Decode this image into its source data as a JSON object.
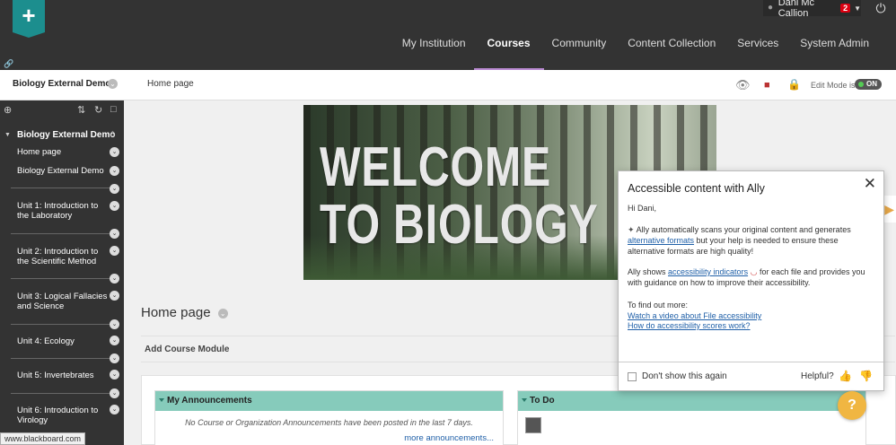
{
  "header": {
    "logo_glyph": "+",
    "user_name": "Dani Mc Callion",
    "notification_count": "2",
    "nav": [
      {
        "label": "My Institution"
      },
      {
        "label": "Courses"
      },
      {
        "label": "Community"
      },
      {
        "label": "Content Collection"
      },
      {
        "label": "Services"
      },
      {
        "label": "System Admin"
      }
    ],
    "active_nav": "Courses"
  },
  "breadcrumb": {
    "course": "Biology External Demo",
    "page": "Home page",
    "edit_mode_label": "Edit Mode is:",
    "edit_mode_value": "ON"
  },
  "sidebar": {
    "course_title": "Biology External Demo",
    "items": [
      {
        "label": "Home page"
      },
      {
        "label": "Biology External Demo"
      },
      {
        "label": "Unit 1: Introduction to the Laboratory"
      },
      {
        "label": "Unit 2: Introduction to the Scientific Method"
      },
      {
        "label": "Unit 3: Logical Fallacies and Science"
      },
      {
        "label": "Unit 4: Ecology"
      },
      {
        "label": "Unit 5: Invertebrates"
      },
      {
        "label": "Unit 6: Introduction to Virology"
      }
    ],
    "status_url": "www.blackboard.com"
  },
  "main": {
    "banner_line1": "WELCOME",
    "banner_line2": "TO BIOLOGY",
    "page_title": "Home page",
    "add_module_label": "Add Course Module",
    "announcements": {
      "title": "My Announcements",
      "empty_text": "No Course or Organization Announcements have been posted in the last 7 days.",
      "more_link": "more announcements..."
    },
    "todo": {
      "title": "To Do"
    }
  },
  "ally": {
    "title": "Accessible content with Ally",
    "greeting": "Hi Dani,",
    "p1_a": "Ally automatically scans your original content and generates",
    "p1_link": "alternative formats",
    "p1_b": "but your help is needed to ensure these alternative formats are high quality!",
    "p2_a": "Ally shows",
    "p2_link": "accessibility indicators",
    "p2_b": "for each file and provides you with guidance on how to improve their accessibility.",
    "find_out": "To find out more:",
    "link_video": "Watch a video about File accessibility",
    "link_scores": "How do accessibility scores work?",
    "dont_show": "Don't show this again",
    "helpful": "Helpful?"
  },
  "colors": {
    "header_bg": "#333333",
    "accent_teal": "#1c8e8e",
    "module_header": "#86cbbb",
    "link": "#2060a8",
    "help_button": "#f0b642"
  }
}
